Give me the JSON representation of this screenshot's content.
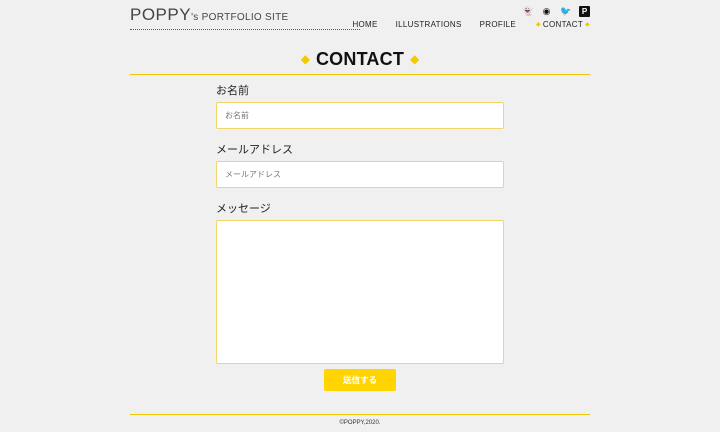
{
  "header": {
    "logo_main": "POPPY",
    "logo_sub": "'s PORTFOLIO SITE",
    "social_icons": [
      "snapchat-icon",
      "weibo-icon",
      "twitter-icon",
      "pixiv-icon"
    ],
    "nav": [
      {
        "label": "HOME"
      },
      {
        "label": "ILLUSTRATIONS"
      },
      {
        "label": "PROFILE"
      },
      {
        "label": "CONTACT",
        "active": true
      }
    ]
  },
  "page": {
    "title": "CONTACT",
    "accent": "#f5c900"
  },
  "form": {
    "name_label": "お名前",
    "name_placeholder": "お名前",
    "email_label": "メールアドレス",
    "email_placeholder": "メールアドレス",
    "message_label": "メッセージ",
    "submit_label": "送信する"
  },
  "footer": {
    "copyright": "©POPPY,2020."
  }
}
